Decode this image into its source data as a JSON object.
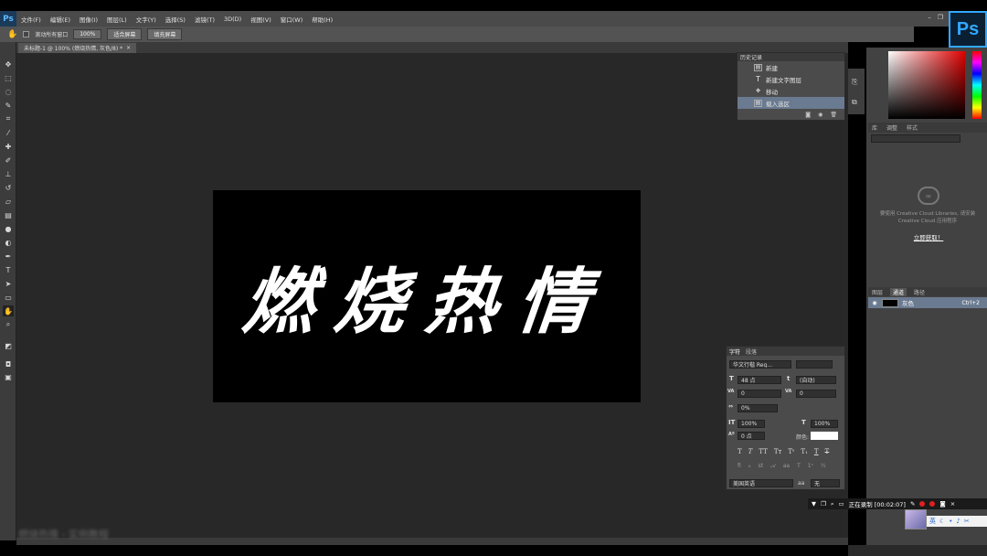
{
  "menubar": {
    "logo": "Ps",
    "items": [
      "文件(F)",
      "编辑(E)",
      "图像(I)",
      "图层(L)",
      "文字(Y)",
      "选择(S)",
      "滤镜(T)",
      "3D(D)",
      "视图(V)",
      "窗口(W)",
      "帮助(H)"
    ]
  },
  "app_logo": "Ps",
  "options": {
    "scroll_all_label": "滚动所有窗口",
    "zoom_btn": "100%",
    "fit_btn": "适合屏幕",
    "fill_btn": "填充屏幕"
  },
  "document_tab": {
    "title": "未标题-1 @ 100% (燃烧热情, 灰色/8) *",
    "close": "×"
  },
  "canvas": {
    "text": "燃烧热情"
  },
  "history": {
    "title": "历史记录",
    "items": [
      "新建",
      "新建文字图层",
      "移动",
      "载入选区"
    ]
  },
  "libraries": {
    "tabs": [
      "库",
      "调整",
      "样式"
    ],
    "message": "要使用 Creative Cloud Libraries, 请安装 Creative Cloud 应用程序",
    "link": "立即获取！"
  },
  "layers": {
    "tabs": [
      "图层",
      "通道",
      "路径"
    ],
    "row_name": "灰色",
    "row_shortcut": "Ctrl+2"
  },
  "character": {
    "tabs": [
      "字符",
      "段落"
    ],
    "font": "华文行楷 Reg...",
    "size": "48 点",
    "leading": "(自动)",
    "kerning": "0",
    "tracking": "0",
    "scale_pct": "0%",
    "vscale": "100%",
    "hscale": "100%",
    "baseline": "0 点",
    "color_label": "颜色:",
    "language": "美国英语",
    "aa_label": "aa",
    "aa_value": "无"
  },
  "recording": {
    "text": "正在录制 [00:02:07]"
  },
  "ime": {
    "text": "英"
  },
  "watermark": "燃烧热情 - 实例教程"
}
